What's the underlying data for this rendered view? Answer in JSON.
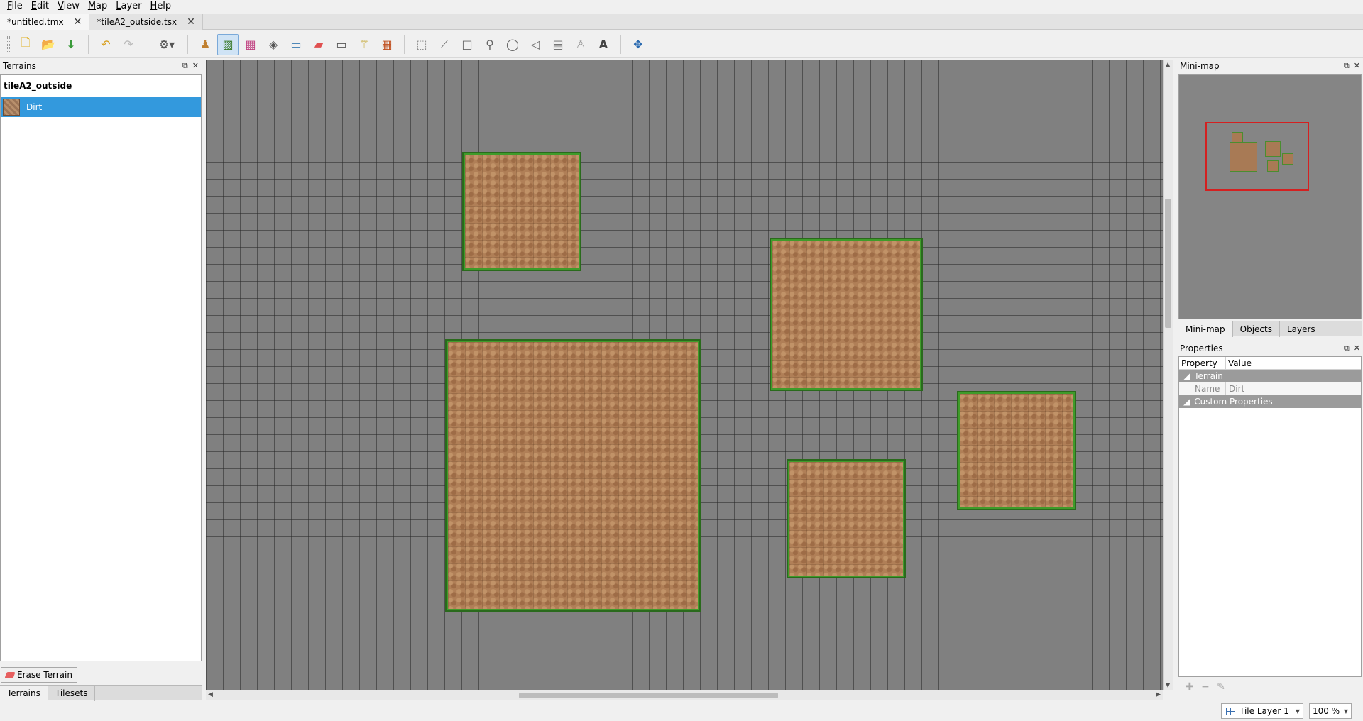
{
  "menu": [
    "File",
    "Edit",
    "View",
    "Map",
    "Layer",
    "Help"
  ],
  "tabs": [
    {
      "label": "*untitled.tmx",
      "active": true
    },
    {
      "label": "*tileA2_outside.tsx",
      "active": false
    }
  ],
  "toolbar": {
    "icons": [
      "new-file-icon",
      "open-icon",
      "save-icon",
      "undo-icon",
      "redo-icon",
      "commands-icon",
      "stamp-brush-icon",
      "terrain-brush-icon",
      "random-mode-icon",
      "bucket-fill-icon",
      "shape-fill-icon",
      "eraser-icon",
      "rect-select-icon",
      "magic-wand-icon",
      "select-same-tile-icon",
      "select-objects-icon",
      "edit-polygons-icon",
      "insert-rectangle-icon",
      "insert-point-icon",
      "insert-ellipse-icon",
      "insert-polygon-icon",
      "insert-tile-icon",
      "insert-template-icon",
      "insert-text-icon",
      "move-icon"
    ]
  },
  "terrains_panel": {
    "title": "Terrains",
    "tileset": "tileA2_outside",
    "terrain": "Dirt",
    "erase_label": "Erase Terrain",
    "tabs": [
      "Terrains",
      "Tilesets"
    ]
  },
  "minimap_panel": {
    "title": "Mini-map",
    "tabs": [
      "Mini-map",
      "Objects",
      "Layers"
    ]
  },
  "properties_panel": {
    "title": "Properties",
    "col_property": "Property",
    "col_value": "Value",
    "group_terrain": "Terrain",
    "name_key": "Name",
    "name_value": "Dirt",
    "group_custom": "Custom Properties"
  },
  "status": {
    "layer": "Tile Layer 1",
    "zoom": "100 %"
  }
}
